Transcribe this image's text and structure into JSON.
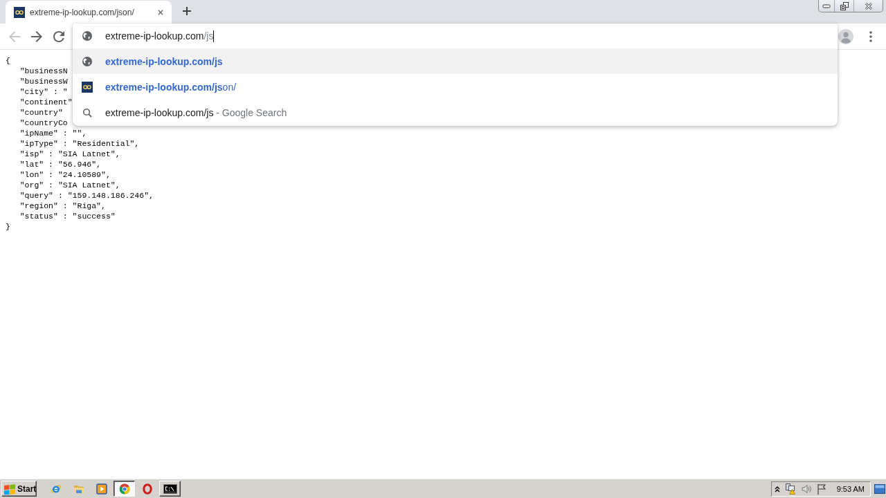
{
  "tabs": [
    {
      "title": "extreme-ip-lookup.com/json/",
      "selected": true
    }
  ],
  "nav": [
    {
      "kind": "back",
      "disabled": true
    },
    {
      "kind": "forward",
      "disabled": false
    },
    {
      "kind": "reload",
      "disabled": false
    }
  ],
  "omnibox": {
    "host": "extreme-ip-lookup.com",
    "path": "/js",
    "focused": true
  },
  "suggestions": [
    {
      "kind": "url",
      "text": "extreme-ip-lookup.com/js",
      "selected": true
    },
    {
      "kind": "site",
      "text": "**extreme-ip-lookup.com/js**on/",
      "selected": false
    },
    {
      "kind": "search",
      "text": "extreme-ip-lookup.com/js",
      "description": "- Google Search",
      "selected": false
    }
  ],
  "page": {
    "open": "{",
    "entries": [
      "\"businessN",
      "\"businessW",
      "\"city\" : \"",
      "\"continent\"",
      "\"country\"",
      "\"countryCo",
      "\"ipName\" : \"\",",
      "\"ipType\" : \"Residential\",",
      "\"isp\" : \"SIA Latnet\",",
      "\"lat\" : \"56.946\",",
      "\"lon\" : \"24.10589\",",
      "\"org\" : \"SIA Latnet\",",
      "\"query\" : \"159.148.186.246\",",
      "\"region\" : \"Riga\",",
      "\"status\" : \"success\""
    ],
    "close": "}"
  },
  "taskbar": {
    "start": "Start",
    "items": [
      {
        "kind": "ie",
        "open": false,
        "selected": false
      },
      {
        "kind": "explorer",
        "open": false,
        "selected": false
      },
      {
        "kind": "media_player",
        "open": false,
        "selected": false
      },
      {
        "kind": "chrome",
        "open": true,
        "selected": true
      },
      {
        "kind": "opera",
        "open": false,
        "selected": false
      },
      {
        "kind": "cmd",
        "open": true,
        "selected": false
      }
    ],
    "clock": "9:53 AM"
  }
}
